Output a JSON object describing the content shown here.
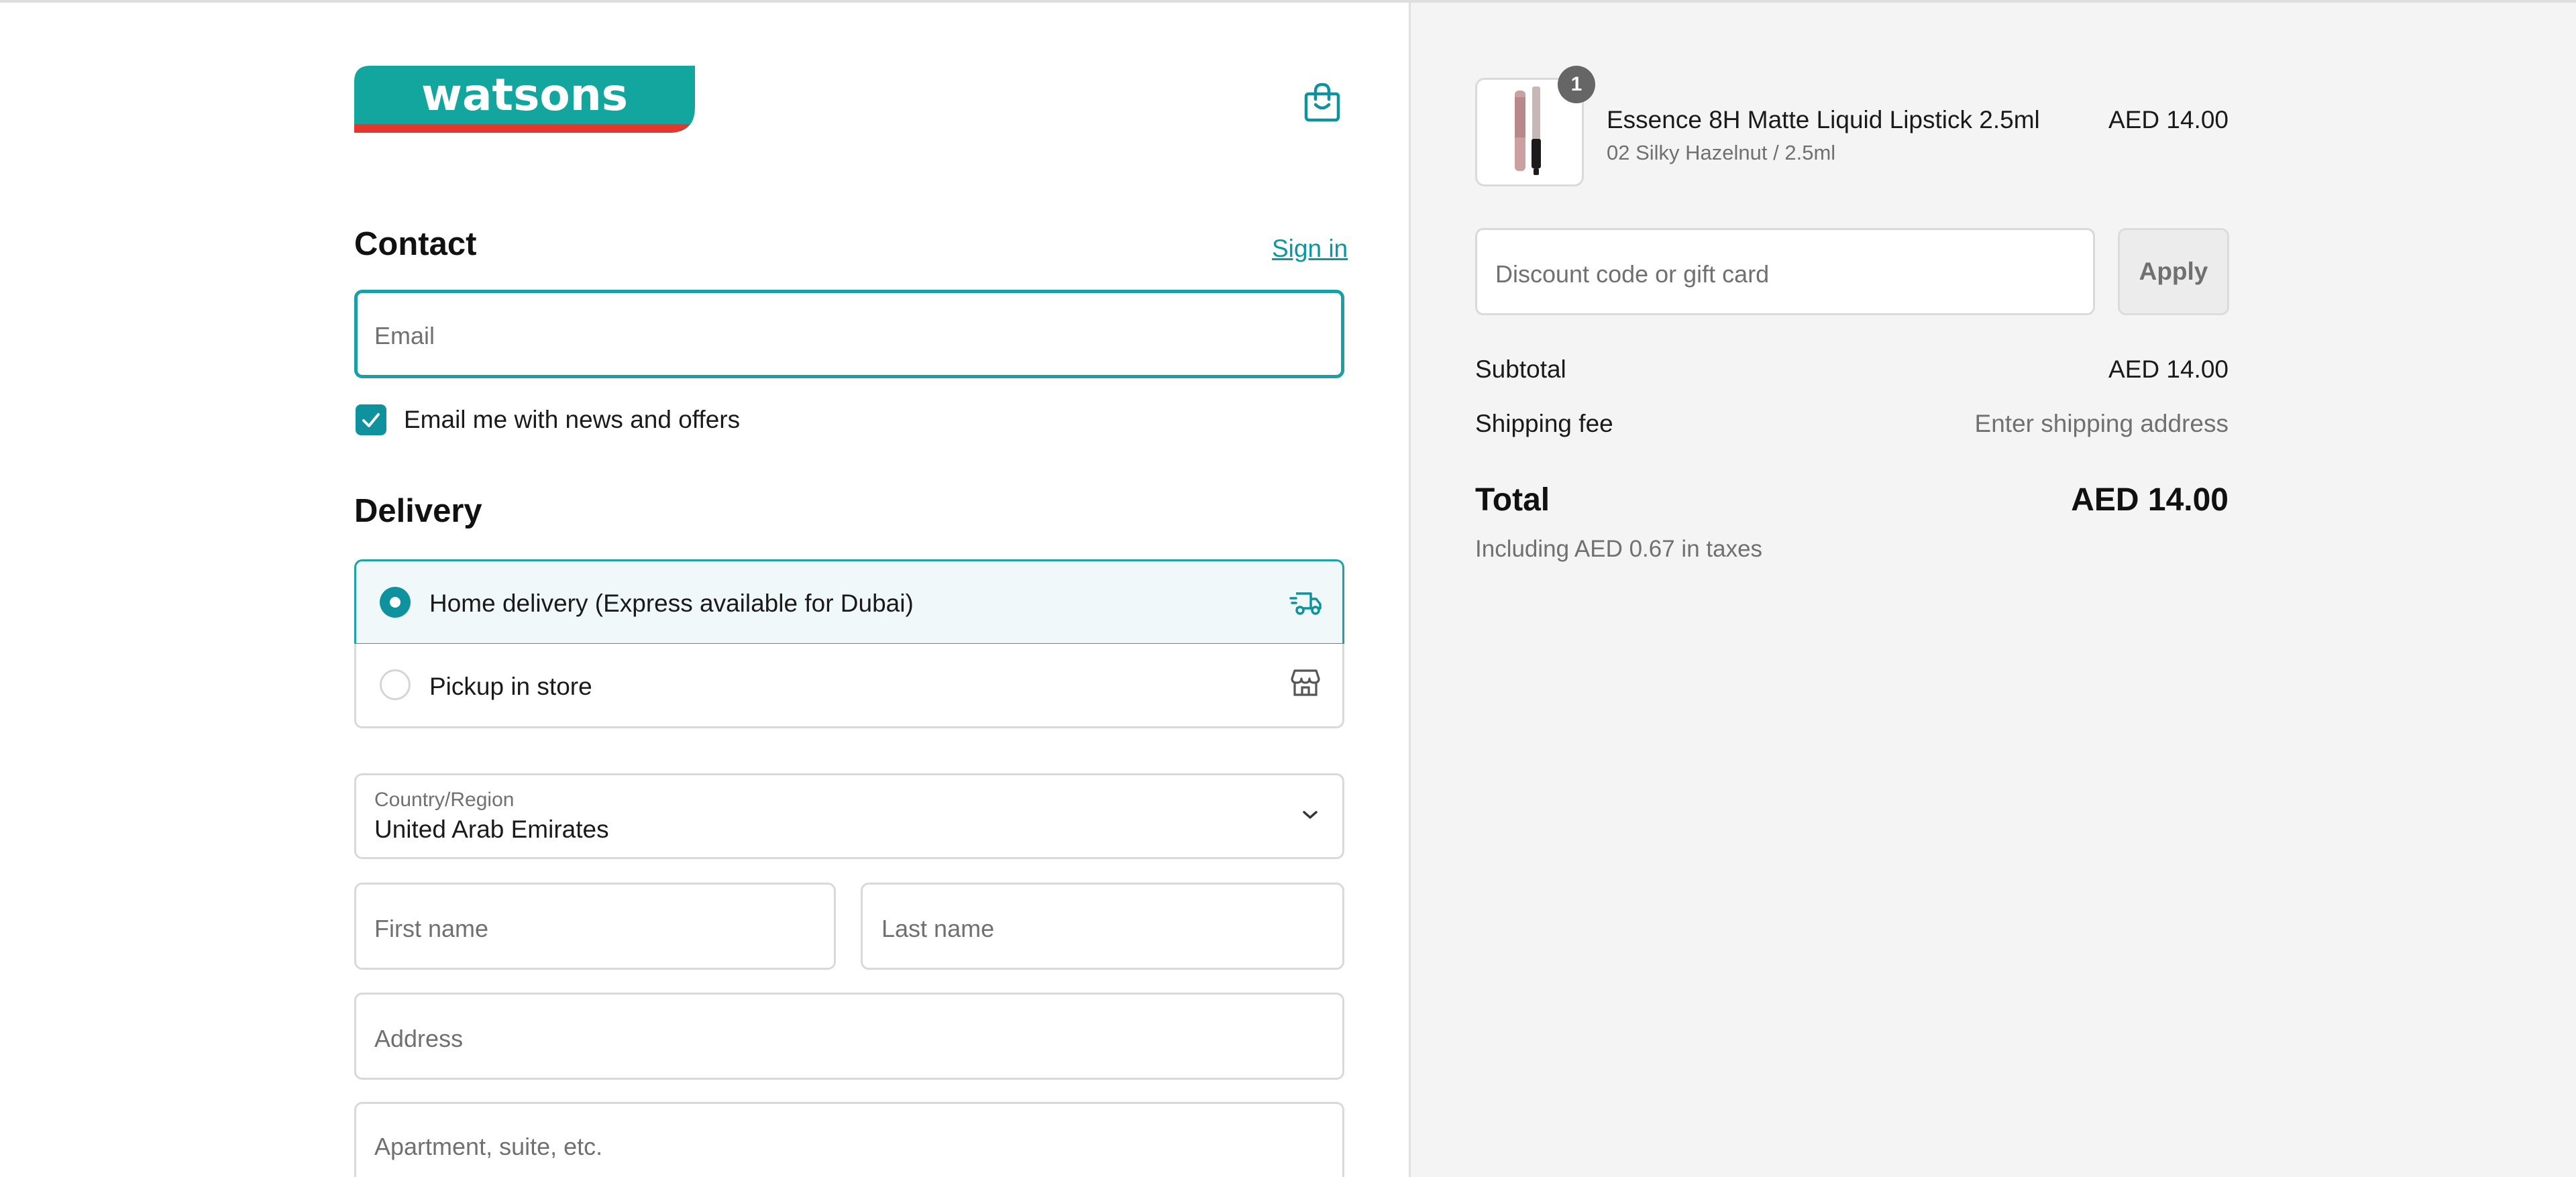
{
  "header": {
    "logo_text": "watsons",
    "bag_icon": "shopping-bag-icon"
  },
  "contact": {
    "title": "Contact",
    "sign_in": "Sign in",
    "email_placeholder": "Email",
    "news_label": "Email me with news and offers",
    "news_checked": true
  },
  "delivery": {
    "title": "Delivery",
    "options": [
      {
        "label": "Home delivery (Express available for Dubai)",
        "selected": true,
        "icon": "delivery-truck-icon"
      },
      {
        "label": "Pickup in store",
        "selected": false,
        "icon": "store-icon"
      }
    ],
    "country_label": "Country/Region",
    "country_value": "United Arab Emirates",
    "first_name_placeholder": "First name",
    "last_name_placeholder": "Last name",
    "address_placeholder": "Address",
    "apartment_placeholder": "Apartment, suite, etc."
  },
  "summary": {
    "item": {
      "quantity": "1",
      "name": "Essence 8H Matte Liquid Lipstick 2.5ml",
      "variant": "02 Silky Hazelnut / 2.5ml",
      "price": "AED 14.00"
    },
    "discount_placeholder": "Discount code or gift card",
    "apply_label": "Apply",
    "subtotal_label": "Subtotal",
    "subtotal_value": "AED 14.00",
    "shipping_label": "Shipping fee",
    "shipping_value": "Enter shipping address",
    "total_label": "Total",
    "total_value": "AED 14.00",
    "taxes_note": "Including AED 0.67 in taxes"
  },
  "colors": {
    "accent": "#0e939e",
    "logo_teal": "#13a69e",
    "logo_red": "#e8352c",
    "summary_bg": "#f4f4f4"
  }
}
